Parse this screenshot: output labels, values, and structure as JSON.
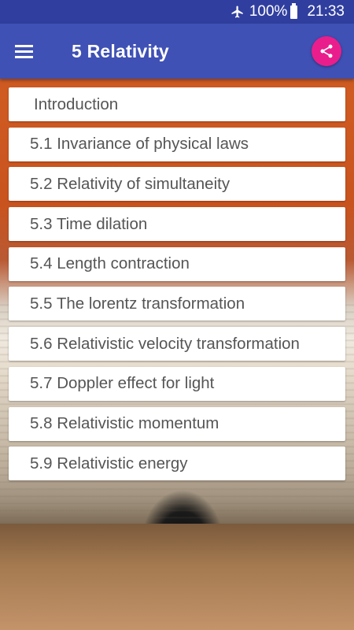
{
  "status_bar": {
    "airplane_icon": "airplane-icon",
    "battery_percent": "100%",
    "battery_icon": "battery-icon",
    "time": "21:33"
  },
  "app_bar": {
    "menu_icon": "hamburger-menu-icon",
    "title": "5 Relativity",
    "share_icon": "share-icon",
    "color": "#3f51b5",
    "status_color": "#303f9f",
    "accent": "#e91e8c"
  },
  "chapters": [
    {
      "label": "Introduction"
    },
    {
      "label": "5.1 Invariance of physical laws"
    },
    {
      "label": "5.2 Relativity of simultaneity"
    },
    {
      "label": "5.3 Time dilation"
    },
    {
      "label": "5.4 Length contraction"
    },
    {
      "label": "5.5 The lorentz transformation"
    },
    {
      "label": "5.6 Relativistic velocity transformation"
    },
    {
      "label": "5.7 Doppler effect for light"
    },
    {
      "label": "5.8 Relativistic momentum"
    },
    {
      "label": "5.9 Relativistic energy"
    }
  ]
}
